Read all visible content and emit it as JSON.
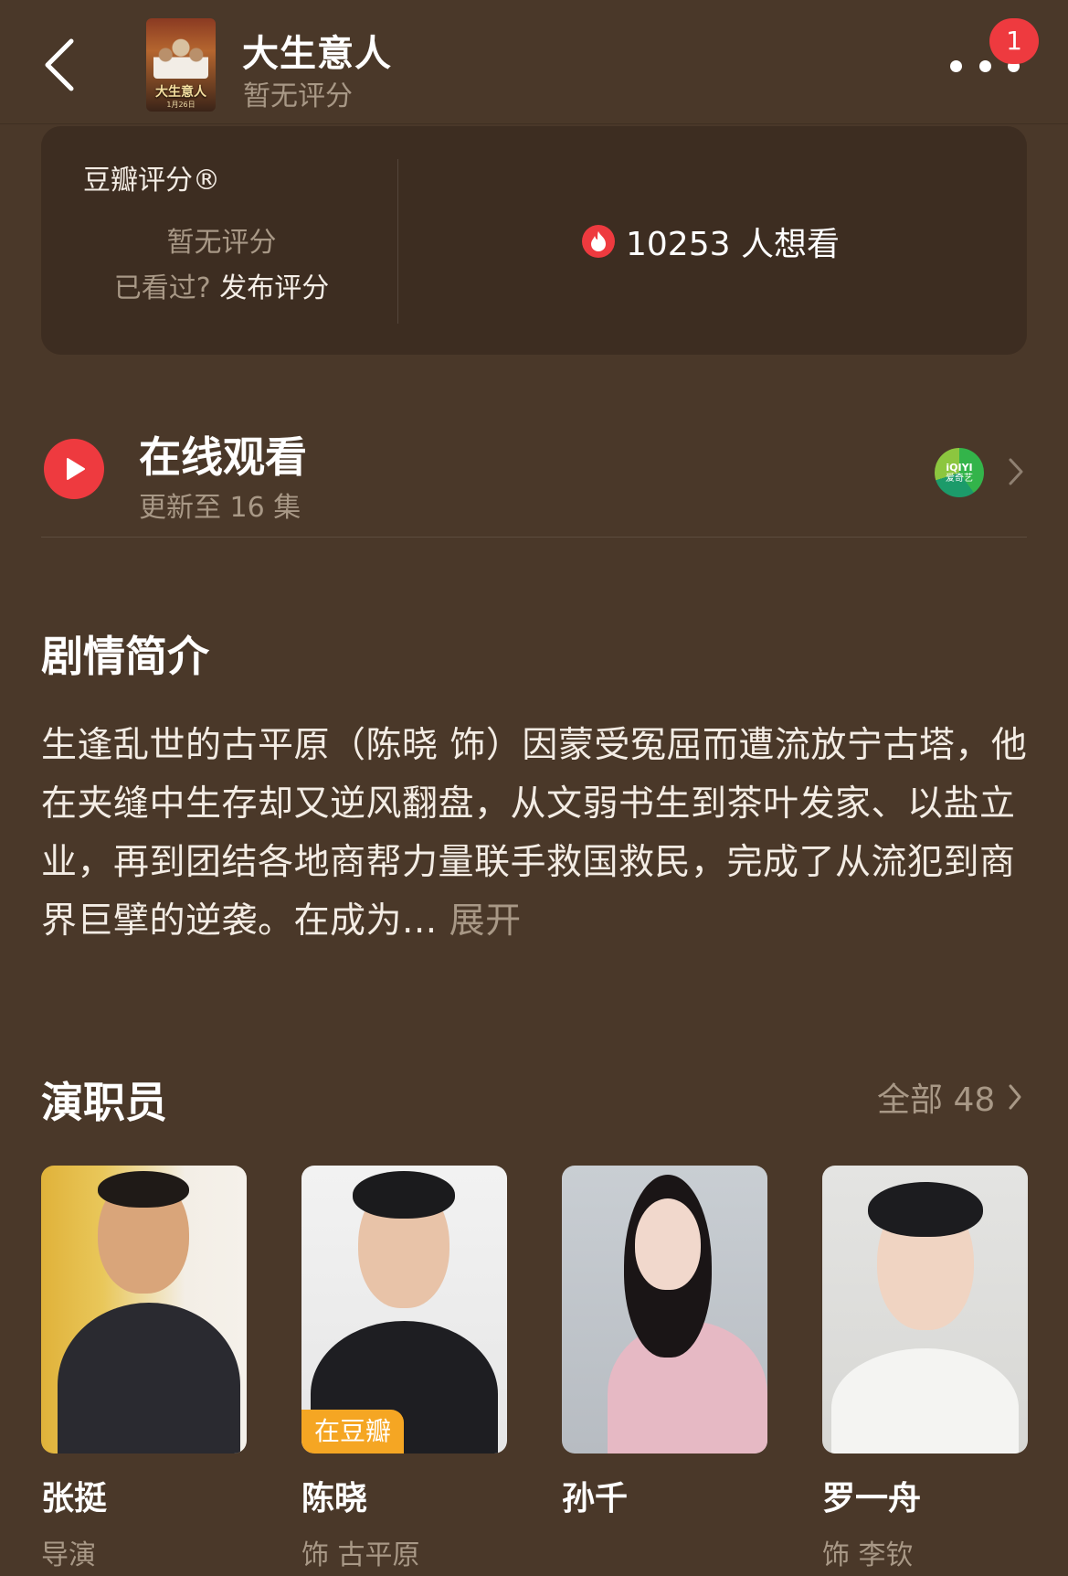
{
  "header": {
    "title": "大生意人",
    "subtitle": "暂无评分",
    "notification_count": "1",
    "poster_title": "大生意人",
    "poster_subtitle": "1月26日"
  },
  "rating": {
    "label": "豆瓣评分®",
    "no_rating": "暂无评分",
    "seen_prompt": "已看过?",
    "post_rating": "发布评分",
    "want_to_watch": "10253 人想看"
  },
  "watch": {
    "title": "在线观看",
    "subtitle": "更新至 16 集",
    "platform_logo_line1": "iQIYI",
    "platform_logo_line2": "爱奇艺"
  },
  "synopsis": {
    "title": "剧情简介",
    "text": "生逢乱世的古平原（陈晓 饰）因蒙受冤屈而遭流放宁古塔，他在夹缝中生存却又逆风翻盘，从文弱书生到茶叶发家、以盐立业，再到团结各地商帮力量联手救国救民，完成了从流犯到商界巨擘的逆袭。在成为...",
    "expand": "展开"
  },
  "cast": {
    "title": "演职员",
    "all_label": "全部 48",
    "members": [
      {
        "name": "张挺",
        "role": "导演",
        "tag": ""
      },
      {
        "name": "陈晓",
        "role": "饰 古平原",
        "tag": "在豆瓣"
      },
      {
        "name": "孙千",
        "role": "",
        "tag": ""
      },
      {
        "name": "罗一舟",
        "role": "饰 李钦",
        "tag": ""
      }
    ]
  },
  "colors": {
    "background": "#4a3829",
    "card": "#3d2d21",
    "accent_red": "#ee3a3f",
    "tag_orange": "#f5a623",
    "muted_text": "#a89886"
  }
}
